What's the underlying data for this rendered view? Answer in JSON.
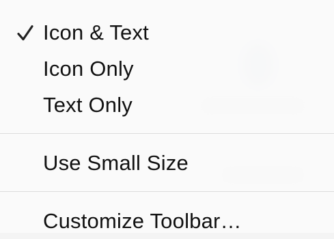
{
  "menu": {
    "view_options": [
      {
        "label": "Icon & Text",
        "checked": true
      },
      {
        "label": "Icon Only",
        "checked": false
      },
      {
        "label": "Text Only",
        "checked": false
      }
    ],
    "size_option": {
      "label": "Use Small Size",
      "checked": false
    },
    "customize": {
      "label": "Customize Toolbar…"
    }
  },
  "icons": {
    "checkmark": "checkmark-icon"
  },
  "colors": {
    "text": "#111111",
    "background": "#fafafa",
    "separator": "#dcdcdc"
  }
}
